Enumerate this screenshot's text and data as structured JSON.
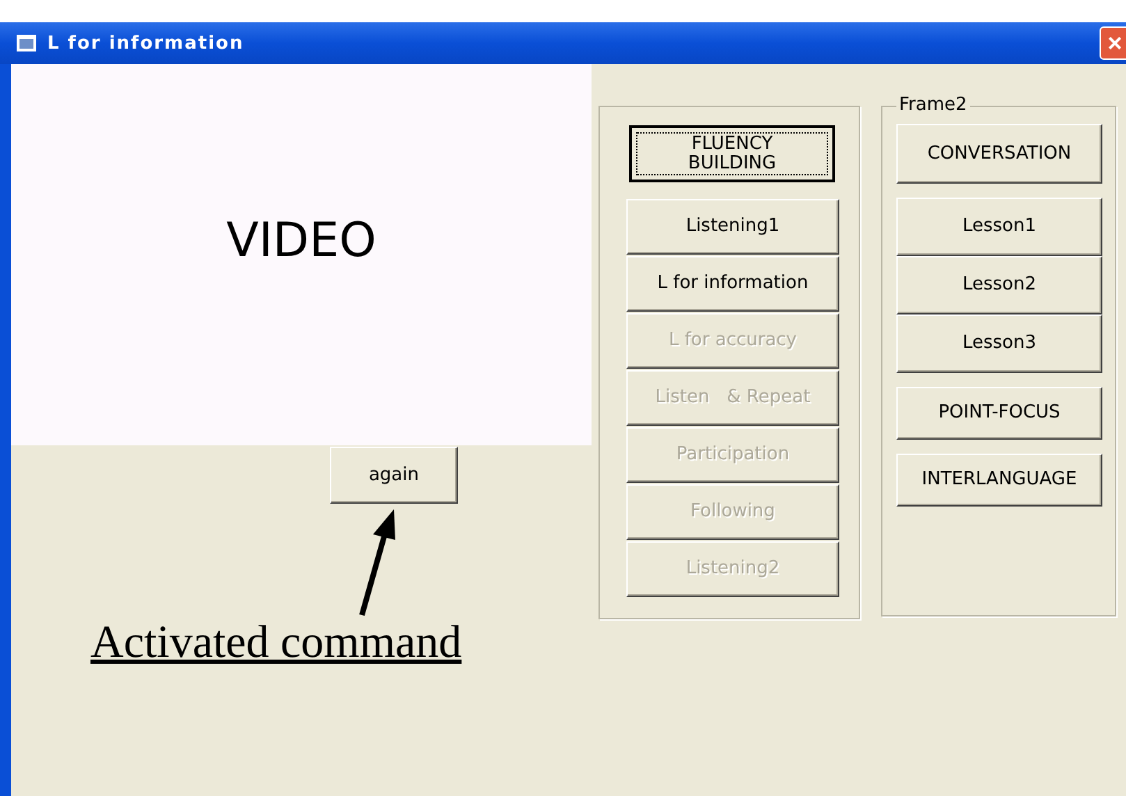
{
  "window": {
    "title": "L for information",
    "close": "×"
  },
  "video": {
    "label": "VIDEO"
  },
  "again_button": {
    "label": "again"
  },
  "annotation": {
    "text": "Activated command"
  },
  "frame1": {
    "buttons": [
      {
        "label": "FLUENCY\nBUILDING",
        "disabled": false,
        "focused": true
      },
      {
        "label": "Listening1",
        "disabled": false,
        "focused": false
      },
      {
        "label": "L for information",
        "disabled": false,
        "focused": false
      },
      {
        "label": "L for accuracy",
        "disabled": true,
        "focused": false
      },
      {
        "label": "Listen   & Repeat",
        "disabled": true,
        "focused": false
      },
      {
        "label": "Participation",
        "disabled": true,
        "focused": false
      },
      {
        "label": "Following",
        "disabled": true,
        "focused": false
      },
      {
        "label": "Listening2",
        "disabled": true,
        "focused": false
      }
    ]
  },
  "frame2": {
    "title": "Frame2",
    "groups": [
      {
        "buttons": [
          {
            "label": "CONVERSATION"
          }
        ]
      },
      {
        "buttons": [
          {
            "label": "Lesson1"
          },
          {
            "label": "Lesson2"
          },
          {
            "label": "Lesson3"
          }
        ]
      },
      {
        "buttons": [
          {
            "label": "POINT-FOCUS"
          }
        ]
      },
      {
        "buttons": [
          {
            "label": "INTERLANGUAGE"
          }
        ]
      }
    ]
  }
}
